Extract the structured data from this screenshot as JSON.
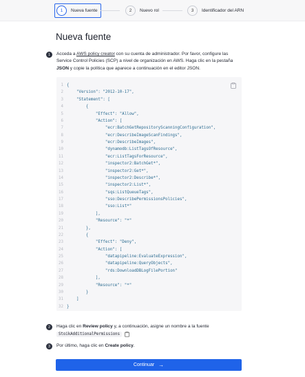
{
  "stepper": {
    "steps": [
      {
        "num": "1",
        "label": "Nueva fuente"
      },
      {
        "num": "2",
        "label": "Nuevo rol"
      },
      {
        "num": "3",
        "label": "Identificador del ARN"
      }
    ]
  },
  "page": {
    "title": "Nueva fuente"
  },
  "step1": {
    "num": "1",
    "t1": "Acceda a ",
    "link": "AWS policy creator",
    "t2": " con su cuenta de administrador. Por favor, configure las Service Control Policies (SCP) a nivel de organización en AWS. Haga clic en la pestaña ",
    "bold": "JSON",
    "t3": " y copie la política que aparece a continuación en el editor JSON."
  },
  "code": {
    "lines": [
      {
        "n": "1",
        "t": "{"
      },
      {
        "n": "2",
        "t": "    \"Version\": \"2012-10-17\","
      },
      {
        "n": "3",
        "t": "    \"Statement\": ["
      },
      {
        "n": "4",
        "t": "        {"
      },
      {
        "n": "5",
        "t": "            \"Effect\": \"Allow\","
      },
      {
        "n": "6",
        "t": "            \"Action\": ["
      },
      {
        "n": "7",
        "t": "                \"ecr:BatchGetRepositoryScanningConfiguration\","
      },
      {
        "n": "8",
        "t": "                \"ecr:DescribeImageScanFindings\","
      },
      {
        "n": "9",
        "t": "                \"ecr:DescribeImages\","
      },
      {
        "n": "10",
        "t": "                \"dynamodb:ListTagsOfResource\","
      },
      {
        "n": "11",
        "t": "                \"ecr:ListTagsForResource\","
      },
      {
        "n": "12",
        "t": "                \"inspector2:BatchGet*\","
      },
      {
        "n": "13",
        "t": "                \"inspector2:Get*\","
      },
      {
        "n": "14",
        "t": "                \"inspector2:Describe*\","
      },
      {
        "n": "15",
        "t": "                \"inspector2:List*\","
      },
      {
        "n": "16",
        "t": "                \"sqs:ListQueueTags\","
      },
      {
        "n": "17",
        "t": "                \"sso:DescribePermissionsPolicies\","
      },
      {
        "n": "18",
        "t": "                \"sso:List*\""
      },
      {
        "n": "19",
        "t": "            ],"
      },
      {
        "n": "20",
        "t": "            \"Resource\": \"*\""
      },
      {
        "n": "21",
        "t": "        },"
      },
      {
        "n": "22",
        "t": "        {"
      },
      {
        "n": "23",
        "t": "            \"Effect\": \"Deny\","
      },
      {
        "n": "24",
        "t": "            \"Action\": ["
      },
      {
        "n": "25",
        "t": "                \"datapipeline:EvaluateExpression\","
      },
      {
        "n": "26",
        "t": "                \"datapipeline:QueryObjects\","
      },
      {
        "n": "27",
        "t": "                \"rds:DownloadDBLogFilePortion\""
      },
      {
        "n": "28",
        "t": "            ],"
      },
      {
        "n": "29",
        "t": "            \"Resource\": \"*\""
      },
      {
        "n": "30",
        "t": "        }"
      },
      {
        "n": "31",
        "t": "    ]"
      },
      {
        "n": "32",
        "t": "}"
      }
    ]
  },
  "step2": {
    "num": "2",
    "t1": "Haga clic en ",
    "bold": "Review policy",
    "t2": " y, a continuación, asigne un nombre a la fuente",
    "policy_name": "StoikAdditionalPermissions"
  },
  "step3": {
    "num": "3",
    "t1": "Por último, haga clic en ",
    "bold": "Create policy",
    "t2": "."
  },
  "continue_button": {
    "label": "Continuar",
    "arrow": "→"
  },
  "colors": {
    "accent": "#1f63e9",
    "code_bg": "#f6f6f8",
    "code_text": "#2e6d92"
  }
}
